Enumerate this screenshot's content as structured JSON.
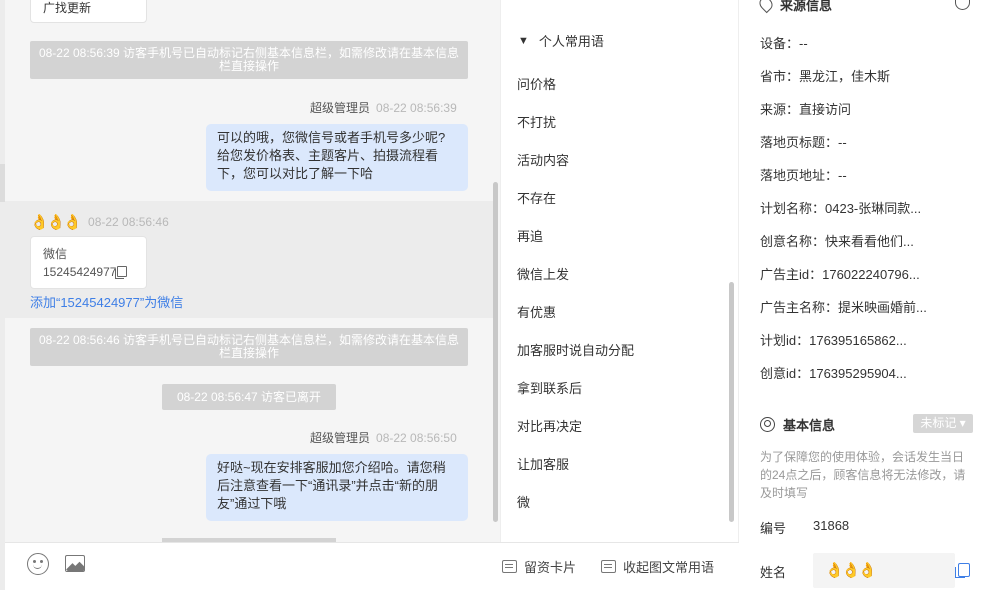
{
  "chat": {
    "prev_bubble_text": "广找更新",
    "sys1": "08-22 08:56:39 访客手机号已自动标记右侧基本信息栏，如需修改请在基本信息栏直接操作",
    "msg1": {
      "sender": "超级管理员",
      "time": "08-22 08:56:39",
      "text": "可以的哦，您微信号或者手机号多少呢?给您发价格表、主题客片、拍摄流程看下，您可以对比了解一下哈"
    },
    "visitor": {
      "emoji": "👌👌👌",
      "time": "08-22 08:56:46",
      "card_title": "微信",
      "card_number": "15245424977",
      "add_link": "添加“15245424977”为微信"
    },
    "sys2": "08-22 08:56:46 访客手机号已自动标记右侧基本信息栏，如需修改请在基本信息栏直接操作",
    "sys3": "08-22 08:56:47 访客已离开",
    "msg2": {
      "sender": "超级管理员",
      "time": "08-22 08:56:50",
      "text": "好哒~现在安排客服加您介绍哈。请您稍后注意查看一下“通讯录”并点击“新的朋友”通过下哦"
    }
  },
  "phrases": {
    "title": "个人常用语",
    "items": [
      "问价格",
      "不打扰",
      "活动内容",
      "不存在",
      "再追",
      "微信上发",
      "有优惠",
      "加客服时说自动分配",
      "拿到联系后",
      "对比再决定",
      "让加客服",
      "微"
    ]
  },
  "toolbar": {
    "leave_card": "留资卡片",
    "collapse": "收起图文常用语"
  },
  "info": {
    "source_title": "来源信息",
    "source_rows": [
      "设备：--",
      "省市：黑龙江，佳木斯",
      "来源：直接访问",
      "落地页标题：--",
      "落地页地址：--",
      "计划名称：0423-张琳同款...",
      "创意名称：快来看看他们...",
      "广告主id：176022240796...",
      "广告主名称：提米映画婚前...",
      "计划id：176395165862...",
      "创意id：176395295904..."
    ],
    "basic_title": "基本信息",
    "tag": "未标记 ▾",
    "hint": "为了保障您的使用体验，会话发生当日的24点之后，顾客信息将无法修改，请及时填写",
    "id_label": "编号",
    "id_value": "31868",
    "name_label": "姓名",
    "name_value": "👌👌👌"
  }
}
